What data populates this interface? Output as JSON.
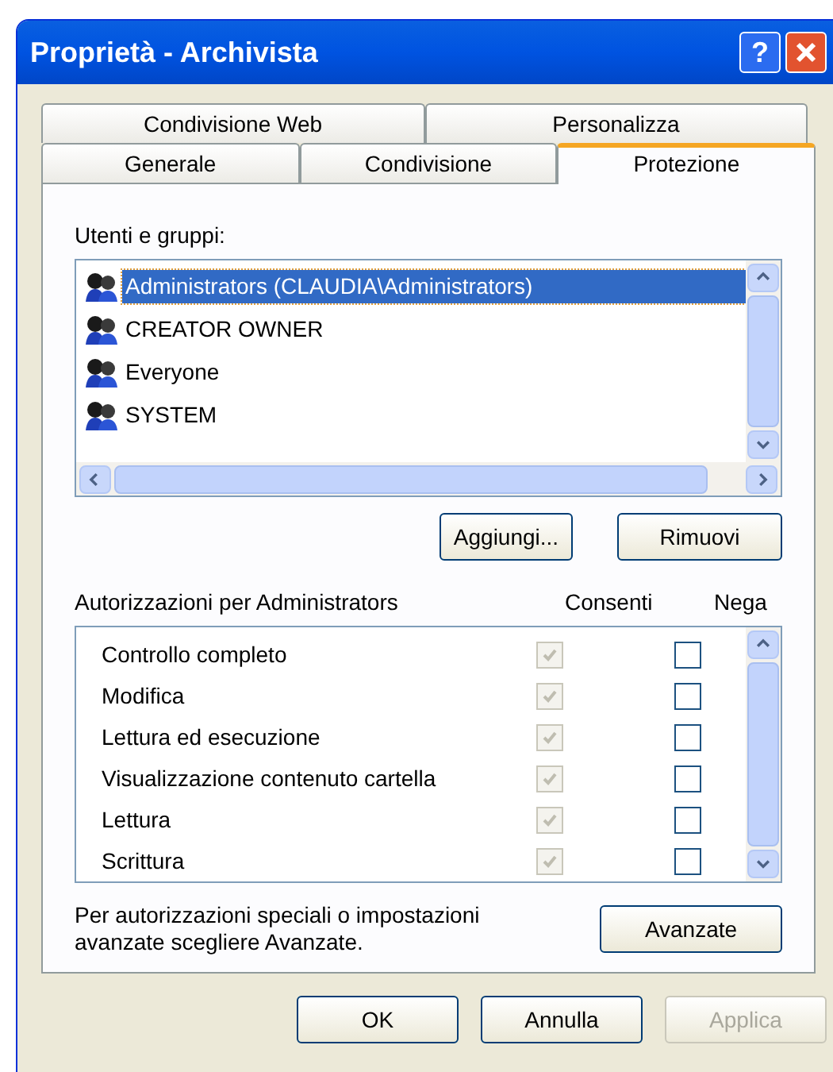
{
  "window": {
    "title": "Proprietà - Archivista",
    "help_button": "?"
  },
  "tab_rows": [
    [
      {
        "label": "Condivisione Web",
        "selected": false
      },
      {
        "label": "Personalizza",
        "selected": false
      }
    ],
    [
      {
        "label": "Generale",
        "selected": false
      },
      {
        "label": "Condivisione",
        "selected": false
      },
      {
        "label": "Protezione",
        "selected": true
      }
    ]
  ],
  "users_label": "Utenti e gruppi:",
  "users": [
    {
      "name": "Administrators (CLAUDIA\\Administrators)",
      "selected": true
    },
    {
      "name": "CREATOR OWNER",
      "selected": false
    },
    {
      "name": "Everyone",
      "selected": false
    },
    {
      "name": "SYSTEM",
      "selected": false
    }
  ],
  "user_buttons": [
    "Aggiungi...",
    "Rimuovi"
  ],
  "permissions_label": "Autorizzazioni per Administrators",
  "allow_header": "Consenti",
  "deny_header": "Nega",
  "permissions": [
    {
      "name": "Controllo completo",
      "allow": true,
      "allow_disabled": true,
      "deny": false
    },
    {
      "name": "Modifica",
      "allow": true,
      "allow_disabled": true,
      "deny": false
    },
    {
      "name": "Lettura ed esecuzione",
      "allow": true,
      "allow_disabled": true,
      "deny": false
    },
    {
      "name": "Visualizzazione contenuto cartella",
      "allow": true,
      "allow_disabled": true,
      "deny": false
    },
    {
      "name": "Lettura",
      "allow": true,
      "allow_disabled": true,
      "deny": false
    },
    {
      "name": "Scrittura",
      "allow": true,
      "allow_disabled": true,
      "deny": false
    }
  ],
  "advanced_note": "Per autorizzazioni speciali o impostazioni avanzate scegliere Avanzate.",
  "advanced_button": "Avanzate",
  "footer_buttons": [
    {
      "label": "OK",
      "disabled": false
    },
    {
      "label": "Annulla",
      "disabled": false
    },
    {
      "label": "Applica",
      "disabled": true
    }
  ]
}
